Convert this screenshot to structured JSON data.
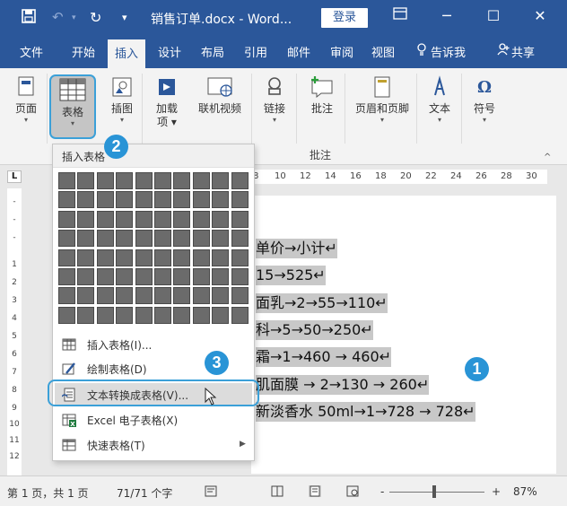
{
  "titlebar": {
    "title": "销售订单.docx - Word...",
    "login": "登录"
  },
  "tabs": [
    "文件",
    "开始",
    "插入",
    "设计",
    "布局",
    "引用",
    "邮件",
    "审阅",
    "视图"
  ],
  "active_tab": "插入",
  "tell_me": "告诉我",
  "share": "共享",
  "ribbon": {
    "page": "页面",
    "table": "表格",
    "illustration": "插图",
    "addins_line1": "加载",
    "addins_line2": "项",
    "online_video": "联机视频",
    "link": "链接",
    "comment": "批注",
    "header_footer": "页眉和页脚",
    "text": "文本",
    "symbol": "符号",
    "group_comment": "批注"
  },
  "ruler_ticks": [
    "8",
    "10",
    "12",
    "14",
    "16",
    "18",
    "20",
    "22",
    "24",
    "26",
    "28",
    "30"
  ],
  "vruler_ticks": [
    "-",
    "-",
    "-",
    "1",
    "2",
    "3",
    "4",
    "5",
    "6",
    "7",
    "8",
    "9",
    "10",
    "11",
    "12"
  ],
  "ruler_corner": "L",
  "dropdown": {
    "header": "插入表格",
    "items": [
      {
        "label": "插入表格(I)...",
        "icon": "table-icon"
      },
      {
        "label": "绘制表格(D)",
        "icon": "pencil-icon"
      },
      {
        "label": "文本转换成表格(V)...",
        "icon": "convert-icon"
      },
      {
        "label": "Excel 电子表格(X)",
        "icon": "excel-icon"
      },
      {
        "label": "快速表格(T)",
        "icon": "table-icon"
      }
    ]
  },
  "document_lines": [
    "单价→小计↵",
    "15→525↵",
    "面乳→2→55→110↵",
    "科→5→50→250↵",
    "霜→1→460 → 460↵",
    "肌面膜 → 2→130 → 260↵",
    "新淡香水 50ml→1→728 → 728↵"
  ],
  "callouts": [
    "1",
    "2",
    "3"
  ],
  "status": {
    "page": "第 1 页，共 1 页",
    "words": "71/71 个字",
    "zoom_minus": "-",
    "zoom_plus": "+",
    "zoom": "87%"
  },
  "colors": {
    "word_blue": "#2b579a",
    "callout": "#2994d6",
    "highlight_outline": "#3ba0d8"
  }
}
